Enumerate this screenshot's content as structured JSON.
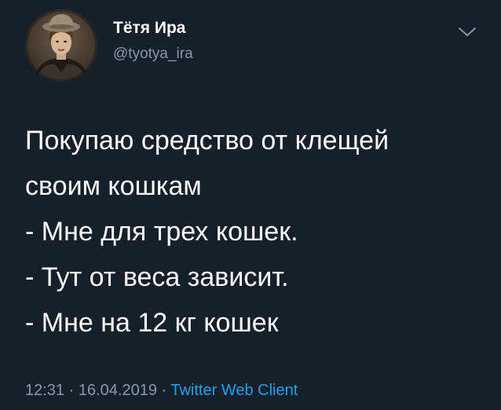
{
  "author": {
    "display_name": "Тётя Ира",
    "handle": "@tyotya_ira"
  },
  "icons": {
    "avatar": "avatar-vintage-portrait",
    "menu": "chevron-down-icon"
  },
  "tweet": {
    "lines": [
      "Покупаю средство от клещей",
      "своим кошкам",
      "- Мне для трех кошек.",
      "- Тут от веса зависит.",
      "- Мне на 12 кг кошек"
    ]
  },
  "meta": {
    "time": "12:31",
    "separator_1": " · ",
    "date": "16.04.2019",
    "separator_2": " · ",
    "source": "Twitter Web Client"
  },
  "colors": {
    "background": "#15202b",
    "text": "#ffffff",
    "secondary": "#8899a6",
    "link": "#1da1f2"
  }
}
